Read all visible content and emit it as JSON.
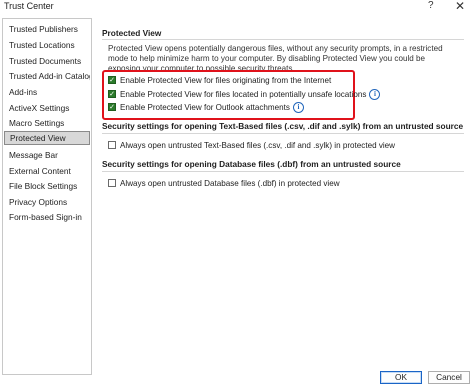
{
  "window": {
    "title": "Trust Center",
    "help_label": "?",
    "close_label": "✕"
  },
  "sidebar": {
    "items": [
      {
        "label": "Trusted Publishers",
        "selected": false
      },
      {
        "label": "Trusted Locations",
        "selected": false
      },
      {
        "label": "Trusted Documents",
        "selected": false
      },
      {
        "label": "Trusted Add-in Catalogs",
        "selected": false
      },
      {
        "label": "Add-ins",
        "selected": false
      },
      {
        "label": "ActiveX Settings",
        "selected": false
      },
      {
        "label": "Macro Settings",
        "selected": false
      },
      {
        "label": "Protected View",
        "selected": true
      },
      {
        "label": "Message Bar",
        "selected": false
      },
      {
        "label": "External Content",
        "selected": false
      },
      {
        "label": "File Block Settings",
        "selected": false
      },
      {
        "label": "Privacy Options",
        "selected": false
      },
      {
        "label": "Form-based Sign-in",
        "selected": false
      }
    ]
  },
  "main": {
    "section_title": "Protected View",
    "description": "Protected View opens potentially dangerous files, without any security prompts, in a restricted mode to help minimize harm to your computer. By disabling Protected View you could be exposing your computer to possible security threats.",
    "options": [
      {
        "label": "Enable Protected View for files originating from the Internet",
        "checked": true,
        "info": false
      },
      {
        "label": "Enable Protected View for files located in potentially unsafe locations",
        "checked": true,
        "info": true
      },
      {
        "label": "Enable Protected View for Outlook attachments",
        "checked": true,
        "info": true
      }
    ],
    "text_section_title": "Security settings for opening Text-Based files (.csv, .dif and .sylk) from an untrusted source",
    "text_option": {
      "label": "Always open untrusted Text-Based files (.csv, .dif and .sylk) in protected view",
      "checked": false
    },
    "db_section_title": "Security settings for opening Database files (.dbf) from an untrusted source",
    "db_option": {
      "label": "Always open untrusted Database files (.dbf) in protected view",
      "checked": false
    },
    "info_glyph": "i"
  },
  "buttons": {
    "ok": "OK",
    "cancel": "Cancel"
  },
  "colors": {
    "highlight_border": "#e0121b",
    "checkbox_checked": "#2b7b2b",
    "info_icon": "#2266bb"
  }
}
